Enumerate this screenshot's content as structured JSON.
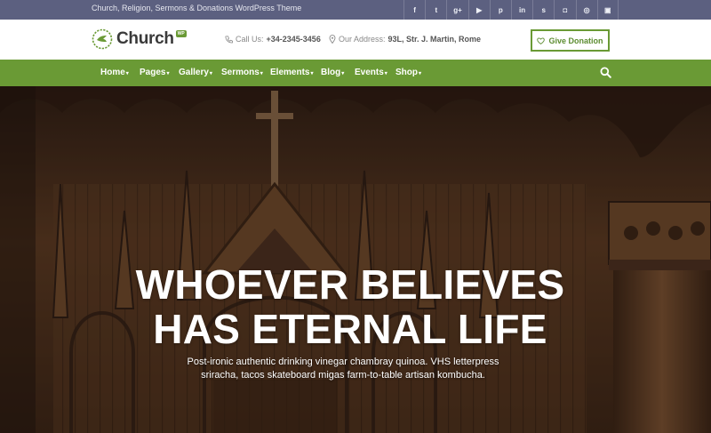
{
  "topbar": {
    "tagline": "Church, Religion, Sermons & Donations WordPress Theme",
    "social_icons": [
      "facebook-icon",
      "twitter-icon",
      "google-plus-icon",
      "youtube-icon",
      "pinterest-icon",
      "linkedin-icon",
      "skype-icon",
      "instagram-icon",
      "dribbble-icon",
      "flickr-icon"
    ],
    "social_glyphs": [
      "f",
      "t",
      "g+",
      "▶",
      "p",
      "in",
      "s",
      "◘",
      "◎",
      "▣"
    ]
  },
  "header": {
    "logo_text": "Church",
    "logo_badge": "WP",
    "call_label": "Call Us:",
    "call_value": "+34-2345-3456",
    "address_label": "Our Address:",
    "address_value": "93L, Str. J. Martin, Rome",
    "donate_label": "Give Donation"
  },
  "nav": {
    "items": [
      "Home",
      "Pages",
      "Gallery",
      "Sermons",
      "Elements",
      "Blog",
      "Events",
      "Shop"
    ]
  },
  "hero": {
    "headline_line1": "WHOEVER BELIEVES",
    "headline_line2": "HAS ETERNAL LIFE",
    "subtext_line1": "Post-ironic authentic drinking vinegar chambray quinoa. VHS letterpress",
    "subtext_line2": "sriracha, tacos skateboard migas farm-to-table artisan kombucha."
  },
  "colors": {
    "topbar": "#5c6080",
    "accent": "#6a9a35",
    "hero_wood": "#5a3a22"
  }
}
